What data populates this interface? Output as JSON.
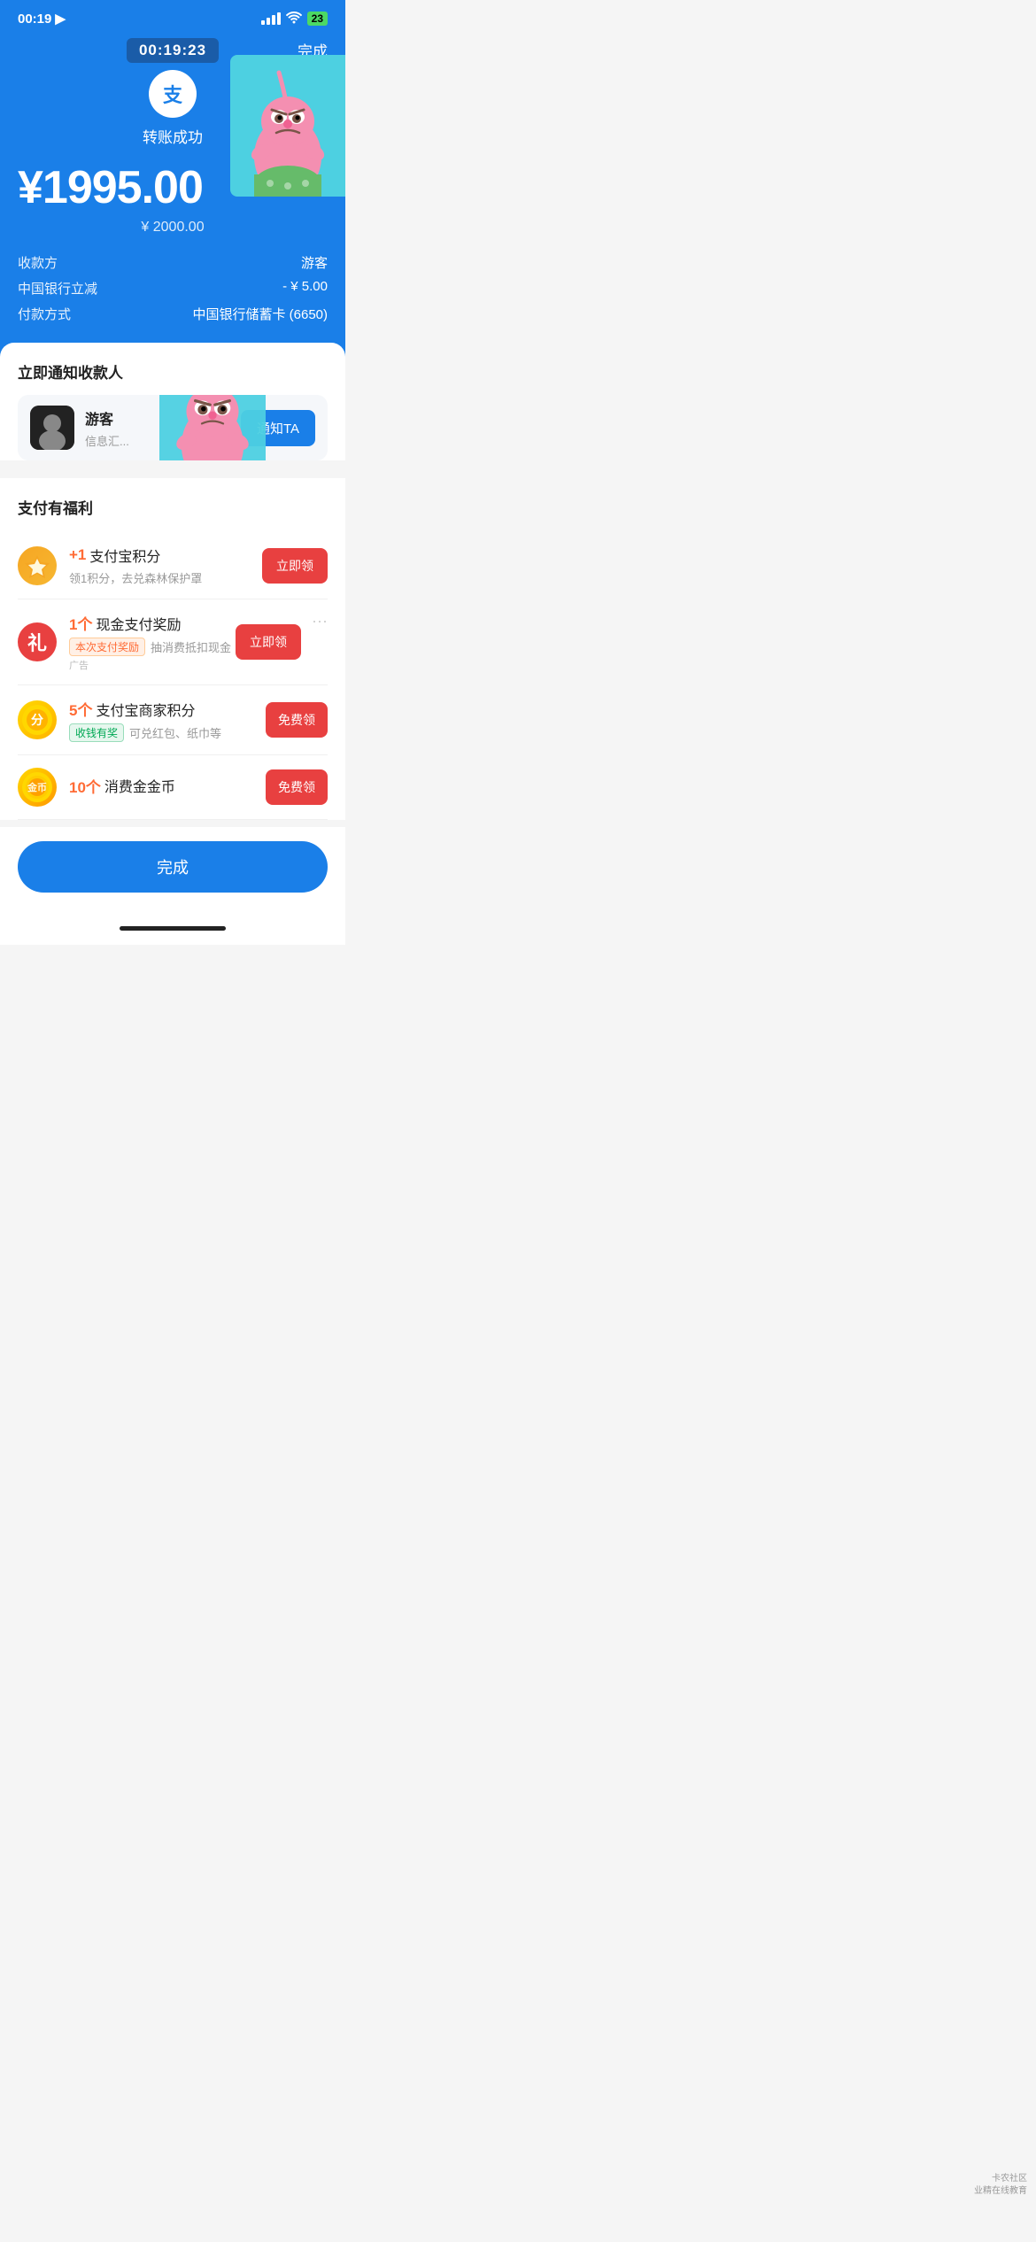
{
  "statusBar": {
    "time": "00:19",
    "battery": "23",
    "locationIcon": "▶"
  },
  "timer": {
    "value": "00:19:23"
  },
  "header": {
    "doneLabel": "完成"
  },
  "transfer": {
    "logoText": "支",
    "successLabel": "转账成功",
    "amountMain": "¥1995.00",
    "amountOriginal": "¥ 2000.00",
    "receiverLabel": "收款方",
    "receiverValue": "游客",
    "discountLabel": "中国银行立减",
    "discountValue": "- ¥ 5.00",
    "paymentLabel": "付款方式",
    "paymentValue": "中国银行储蓄卡 (6650)"
  },
  "notify": {
    "title": "立即通知收款人",
    "contactName": "游客",
    "contactSub": "信息汇...",
    "notifyBtn": "通知TA"
  },
  "benefits": {
    "title": "支付有福利",
    "items": [
      {
        "iconType": "gold",
        "iconChar": "◆",
        "num": "+1",
        "label": "支付宝积分",
        "sub": "领1积分，去兑森林保护罩",
        "tag": "",
        "tagType": "",
        "btnLabel": "立即领",
        "adLabel": ""
      },
      {
        "iconType": "red",
        "iconChar": "礼",
        "num": "1个",
        "label": "现金支付奖励",
        "sub": "抽消费抵扣现金",
        "tag": "本次支付奖励",
        "tagType": "orange",
        "btnLabel": "立即领",
        "adLabel": "广告"
      },
      {
        "iconType": "merchant",
        "iconChar": "🟡",
        "num": "5个",
        "label": "支付宝商家积分",
        "sub": "可兑红包、纸巾等",
        "tag": "收钱有奖",
        "tagType": "green",
        "btnLabel": "免费领",
        "adLabel": ""
      },
      {
        "iconType": "coin",
        "iconChar": "🪙",
        "num": "10个",
        "label": "消费金金币",
        "sub": "",
        "tag": "",
        "tagType": "",
        "btnLabel": "免费领",
        "adLabel": ""
      }
    ]
  },
  "bottomBtn": {
    "label": "完成"
  },
  "watermark": {
    "line1": "卡农社区",
    "line2": "业精在线教育"
  }
}
